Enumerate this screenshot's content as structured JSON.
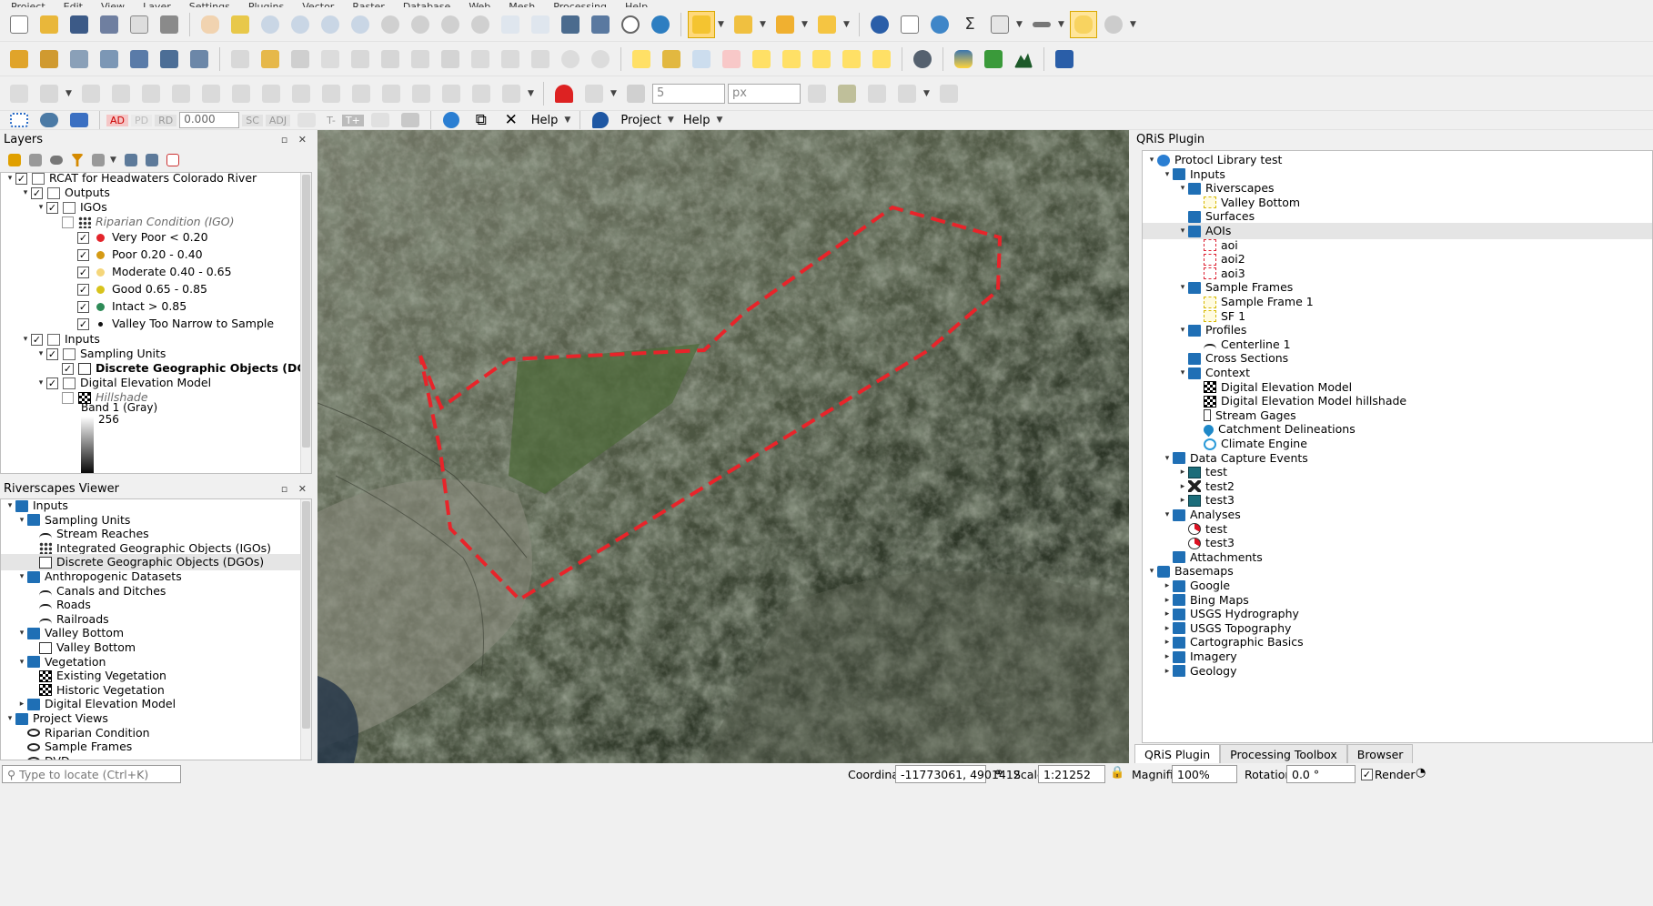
{
  "menu": [
    "Project",
    "Edit",
    "View",
    "Layer",
    "Settings",
    "Plugins",
    "Vector",
    "Raster",
    "Database",
    "Web",
    "Mesh",
    "Processing",
    "Help"
  ],
  "toolbar4": {
    "ad": "AD",
    "rd": "RD",
    "value": "0.000",
    "sc": "SC",
    "adj": "ADJ",
    "help1": "Help",
    "project": "Project",
    "help2": "Help"
  },
  "toolbar3": {
    "snap_value": "5",
    "snap_unit": "px"
  },
  "layers_panel": {
    "title": "Layers",
    "controls": "▫ ✕",
    "rows": [
      {
        "label": "RCAT for Headwaters Colorado River",
        "indent": 0,
        "arrow": "▾",
        "check": true,
        "icon": "group"
      },
      {
        "label": "Outputs",
        "indent": 1,
        "arrow": "▾",
        "check": true,
        "icon": "group"
      },
      {
        "label": "IGOs",
        "indent": 2,
        "arrow": "▾",
        "check": true,
        "icon": "group"
      },
      {
        "label": "Riparian Condition (IGO)",
        "indent": 3,
        "arrow": "",
        "check": false,
        "icon": "points",
        "italic": true,
        "muted": true
      },
      {
        "label": "Very Poor < 0.20",
        "indent": 4,
        "arrow": "",
        "check": true,
        "color": "#e3242b"
      },
      {
        "label": "Poor 0.20 - 0.40",
        "indent": 4,
        "arrow": "",
        "check": true,
        "color": "#d59a14"
      },
      {
        "label": "Moderate 0.40 - 0.65",
        "indent": 4,
        "arrow": "",
        "check": true,
        "color": "#f5d67a"
      },
      {
        "label": "Good 0.65 - 0.85",
        "indent": 4,
        "arrow": "",
        "check": true,
        "color": "#d8c31c"
      },
      {
        "label": "Intact > 0.85",
        "indent": 4,
        "arrow": "",
        "check": true,
        "color": "#2e8b57"
      },
      {
        "label": "Valley Too Narrow to Sample",
        "indent": 4,
        "arrow": "",
        "check": true,
        "color": "#111111",
        "small": true
      },
      {
        "label": "Inputs",
        "indent": 1,
        "arrow": "▾",
        "check": true,
        "icon": "group"
      },
      {
        "label": "Sampling Units",
        "indent": 2,
        "arrow": "▾",
        "check": true,
        "icon": "group"
      },
      {
        "label": "Discrete Geographic Objects (DGOs)",
        "indent": 3,
        "arrow": "",
        "check": true,
        "icon": "polygon",
        "bold": true
      },
      {
        "label": "Digital Elevation Model",
        "indent": 2,
        "arrow": "▾",
        "check": true,
        "icon": "group"
      },
      {
        "label": "Hillshade",
        "indent": 3,
        "arrow": "",
        "check": false,
        "icon": "raster",
        "italic": true,
        "muted": true
      }
    ],
    "band_label": "Band 1 (Gray)",
    "band_max": "256"
  },
  "rv_panel": {
    "title": "Riverscapes Viewer",
    "controls": "▫ ✕",
    "rows": [
      {
        "label": "Inputs",
        "indent": 0,
        "arrow": "▾",
        "icon": "folder"
      },
      {
        "label": "Sampling Units",
        "indent": 1,
        "arrow": "▾",
        "icon": "folder"
      },
      {
        "label": "Stream Reaches",
        "indent": 2,
        "arrow": "",
        "icon": "line"
      },
      {
        "label": "Integrated Geographic Objects (IGOs)",
        "indent": 2,
        "arrow": "",
        "icon": "points"
      },
      {
        "label": "Discrete Geographic Objects (DGOs)",
        "indent": 2,
        "arrow": "",
        "icon": "polygon",
        "selected": true
      },
      {
        "label": "Anthropogenic Datasets",
        "indent": 1,
        "arrow": "▾",
        "icon": "folder"
      },
      {
        "label": "Canals and Ditches",
        "indent": 2,
        "arrow": "",
        "icon": "line"
      },
      {
        "label": "Roads",
        "indent": 2,
        "arrow": "",
        "icon": "line"
      },
      {
        "label": "Railroads",
        "indent": 2,
        "arrow": "",
        "icon": "line"
      },
      {
        "label": "Valley Bottom",
        "indent": 1,
        "arrow": "▾",
        "icon": "folder"
      },
      {
        "label": "Valley Bottom",
        "indent": 2,
        "arrow": "",
        "icon": "polygon"
      },
      {
        "label": "Vegetation",
        "indent": 1,
        "arrow": "▾",
        "icon": "folder"
      },
      {
        "label": "Existing Vegetation",
        "indent": 2,
        "arrow": "",
        "icon": "raster"
      },
      {
        "label": "Historic Vegetation",
        "indent": 2,
        "arrow": "",
        "icon": "raster"
      },
      {
        "label": "Digital Elevation Model",
        "indent": 1,
        "arrow": "▸",
        "icon": "folder"
      },
      {
        "label": "Project Views",
        "indent": 0,
        "arrow": "▾",
        "icon": "folder"
      },
      {
        "label": "Riparian Condition",
        "indent": 1,
        "arrow": "",
        "icon": "eye"
      },
      {
        "label": "Sample Frames",
        "indent": 1,
        "arrow": "",
        "icon": "eye"
      },
      {
        "label": "DVD",
        "indent": 1,
        "arrow": "",
        "icon": "eye"
      }
    ]
  },
  "qris_panel": {
    "title": "QRiS Plugin",
    "rows": [
      {
        "label": "Protocl Library test",
        "indent": 0,
        "arrow": "▾",
        "icon": "globe"
      },
      {
        "label": "Inputs",
        "indent": 1,
        "arrow": "▾",
        "icon": "folder"
      },
      {
        "label": "Riverscapes",
        "indent": 2,
        "arrow": "▾",
        "icon": "folder"
      },
      {
        "label": "Valley Bottom",
        "indent": 3,
        "arrow": "",
        "icon": "dashy"
      },
      {
        "label": "Surfaces",
        "indent": 2,
        "arrow": "",
        "icon": "folder"
      },
      {
        "label": "AOIs",
        "indent": 2,
        "arrow": "▾",
        "icon": "folder",
        "selected": true
      },
      {
        "label": "aoi",
        "indent": 3,
        "arrow": "",
        "icon": "dash"
      },
      {
        "label": "aoi2",
        "indent": 3,
        "arrow": "",
        "icon": "dash"
      },
      {
        "label": "aoi3",
        "indent": 3,
        "arrow": "",
        "icon": "dash"
      },
      {
        "label": "Sample Frames",
        "indent": 2,
        "arrow": "▾",
        "icon": "folder"
      },
      {
        "label": "Sample Frame 1",
        "indent": 3,
        "arrow": "",
        "icon": "dashy"
      },
      {
        "label": "SF 1",
        "indent": 3,
        "arrow": "",
        "icon": "dashy"
      },
      {
        "label": "Profiles",
        "indent": 2,
        "arrow": "▾",
        "icon": "folder"
      },
      {
        "label": "Centerline 1",
        "indent": 3,
        "arrow": "",
        "icon": "line"
      },
      {
        "label": "Cross Sections",
        "indent": 2,
        "arrow": "",
        "icon": "folder"
      },
      {
        "label": "Context",
        "indent": 2,
        "arrow": "▾",
        "icon": "folder"
      },
      {
        "label": "Digital Elevation Model",
        "indent": 3,
        "arrow": "",
        "icon": "raster"
      },
      {
        "label": "Digital Elevation Model hillshade",
        "indent": 3,
        "arrow": "",
        "icon": "raster"
      },
      {
        "label": "Stream Gages",
        "indent": 3,
        "arrow": "",
        "icon": "gage"
      },
      {
        "label": "Catchment Delineations",
        "indent": 3,
        "arrow": "",
        "icon": "drop"
      },
      {
        "label": "Climate Engine",
        "indent": 3,
        "arrow": "",
        "icon": "climate"
      },
      {
        "label": "Data Capture Events",
        "indent": 1,
        "arrow": "▾",
        "icon": "folder"
      },
      {
        "label": "test",
        "indent": 2,
        "arrow": "▸",
        "icon": "calendar"
      },
      {
        "label": "test2",
        "indent": 2,
        "arrow": "▸",
        "icon": "tools"
      },
      {
        "label": "test3",
        "indent": 2,
        "arrow": "▸",
        "icon": "calendar"
      },
      {
        "label": "Analyses",
        "indent": 1,
        "arrow": "▾",
        "icon": "folder"
      },
      {
        "label": "test",
        "indent": 2,
        "arrow": "",
        "icon": "pie"
      },
      {
        "label": "test3",
        "indent": 2,
        "arrow": "",
        "icon": "pie"
      },
      {
        "label": "Attachments",
        "indent": 1,
        "arrow": "",
        "icon": "folder"
      },
      {
        "label": "Basemaps",
        "indent": 0,
        "arrow": "▾",
        "icon": "book"
      },
      {
        "label": "Google",
        "indent": 1,
        "arrow": "▸",
        "icon": "folder"
      },
      {
        "label": "Bing Maps",
        "indent": 1,
        "arrow": "▸",
        "icon": "folder"
      },
      {
        "label": "USGS Hydrography",
        "indent": 1,
        "arrow": "▸",
        "icon": "folder"
      },
      {
        "label": "USGS Topography",
        "indent": 1,
        "arrow": "▸",
        "icon": "folder"
      },
      {
        "label": "Cartographic Basics",
        "indent": 1,
        "arrow": "▸",
        "icon": "folder"
      },
      {
        "label": "Imagery",
        "indent": 1,
        "arrow": "▸",
        "icon": "folder"
      },
      {
        "label": "Geology",
        "indent": 1,
        "arrow": "▸",
        "icon": "folder"
      }
    ],
    "tabs": [
      "QRiS Plugin",
      "Processing Toolbox",
      "Browser"
    ]
  },
  "status": {
    "locate_placeholder": "Type to locate (Ctrl+K)",
    "coordinate_label": "Coordinate",
    "coordinate": "-11773061, 4901412",
    "scale_label": "Scale",
    "scale": "1:21252",
    "magnifier_label": "Magnifier",
    "magnifier": "100%",
    "rotation_label": "Rotation",
    "rotation": "0.0 °",
    "render_label": "Render"
  },
  "colors": {
    "aoi_line": "#e8242a",
    "accent": "#1f6fb5"
  }
}
